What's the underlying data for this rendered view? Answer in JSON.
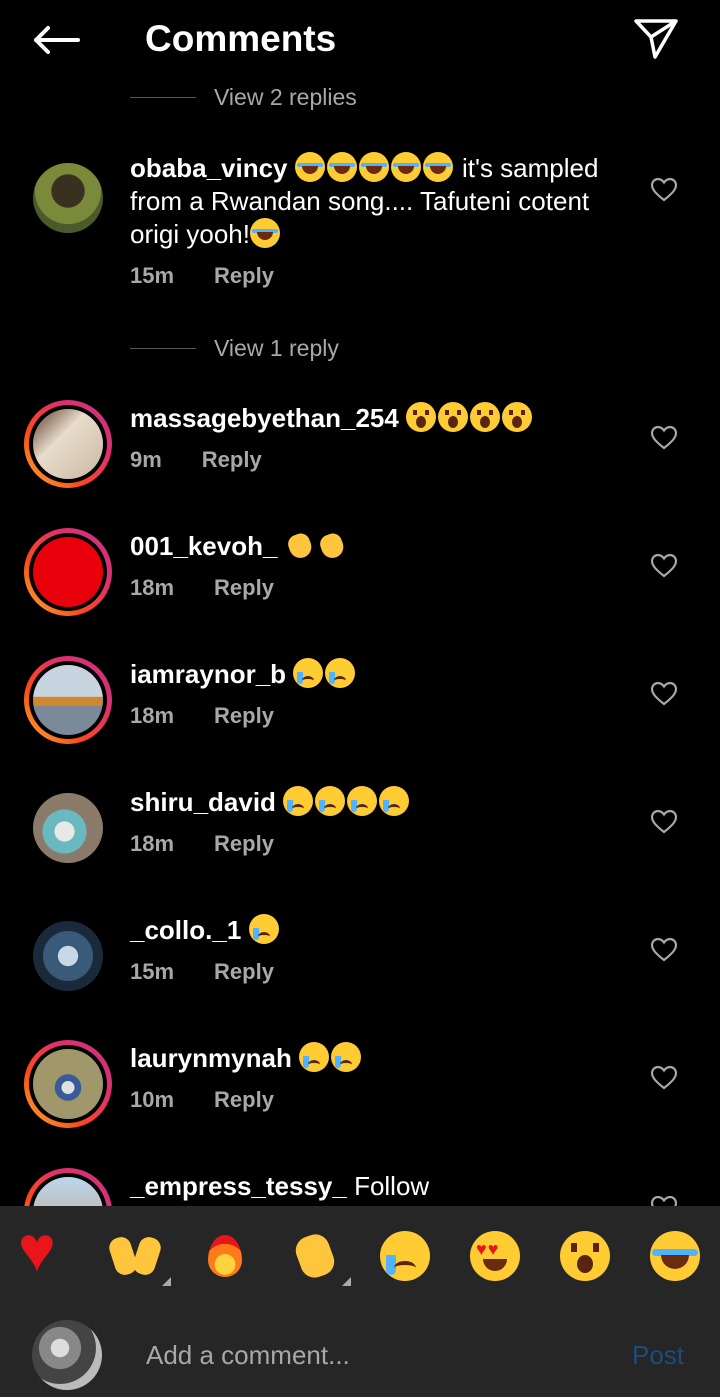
{
  "header": {
    "title": "Comments"
  },
  "list": {
    "top_view_replies": "View 2 replies",
    "comments": [
      {
        "username": "obaba_vincy",
        "text_before": "",
        "emojis_mid": [
          "laugh",
          "laugh",
          "laugh",
          "laugh",
          "laugh"
        ],
        "text": " it's sampled from a Rwandan song.... Tafuteni cotent origi yooh!",
        "emojis_end": [
          "laugh"
        ],
        "time": "15m",
        "reply": "Reply",
        "ring": false,
        "avatar_color": "#6a6a2a",
        "view_replies": "View 1 reply"
      },
      {
        "username": "massagebyethan_254",
        "text": "",
        "emojis_mid": [
          "wow",
          "wow",
          "wow",
          "wow"
        ],
        "emojis_end": [],
        "time": "9m",
        "reply": "Reply",
        "ring": true,
        "avatar_color": "#d9cbb6"
      },
      {
        "username": "001_kevoh_",
        "text": "",
        "emojis_mid": [
          "clap",
          "clap"
        ],
        "emojis_end": [],
        "time": "18m",
        "reply": "Reply",
        "ring": true,
        "avatar_color": "#e8000a"
      },
      {
        "username": "iamraynor_b",
        "text": "",
        "emojis_mid": [
          "cry",
          "cry"
        ],
        "emojis_end": [],
        "time": "18m",
        "reply": "Reply",
        "ring": true,
        "avatar_color": "#7a8a9a"
      },
      {
        "username": "shiru_david",
        "text": "",
        "emojis_mid": [
          "cry",
          "cry",
          "cry",
          "cry"
        ],
        "emojis_end": [],
        "time": "18m",
        "reply": "Reply",
        "ring": false,
        "avatar_color": "#8aa5a8"
      },
      {
        "username": "_collo._1",
        "text": "",
        "emojis_mid": [
          "cry"
        ],
        "emojis_end": [],
        "time": "15m",
        "reply": "Reply",
        "ring": false,
        "avatar_color": "#2a3a4a"
      },
      {
        "username": "laurynmynah",
        "text": "",
        "emojis_mid": [
          "cry",
          "cry"
        ],
        "emojis_end": [],
        "time": "10m",
        "reply": "Reply",
        "ring": true,
        "avatar_color": "#b8a890"
      },
      {
        "username": "_empress_tessy_",
        "text": " Follow",
        "emojis_mid": [],
        "emojis_end": [],
        "time": "",
        "reply": "",
        "ring": true,
        "avatar_color": "#c8a080"
      }
    ]
  },
  "reactions": [
    "heart",
    "raised-hands",
    "fire",
    "clap",
    "crying",
    "heart-eyes",
    "wow",
    "laughing"
  ],
  "composer": {
    "placeholder": "Add a comment...",
    "post_label": "Post"
  },
  "colors": {
    "post": "#1b4d7a",
    "ring_start": "#f7b733",
    "ring_end": "#c13584",
    "background": "#000000",
    "bar": "#262626"
  }
}
